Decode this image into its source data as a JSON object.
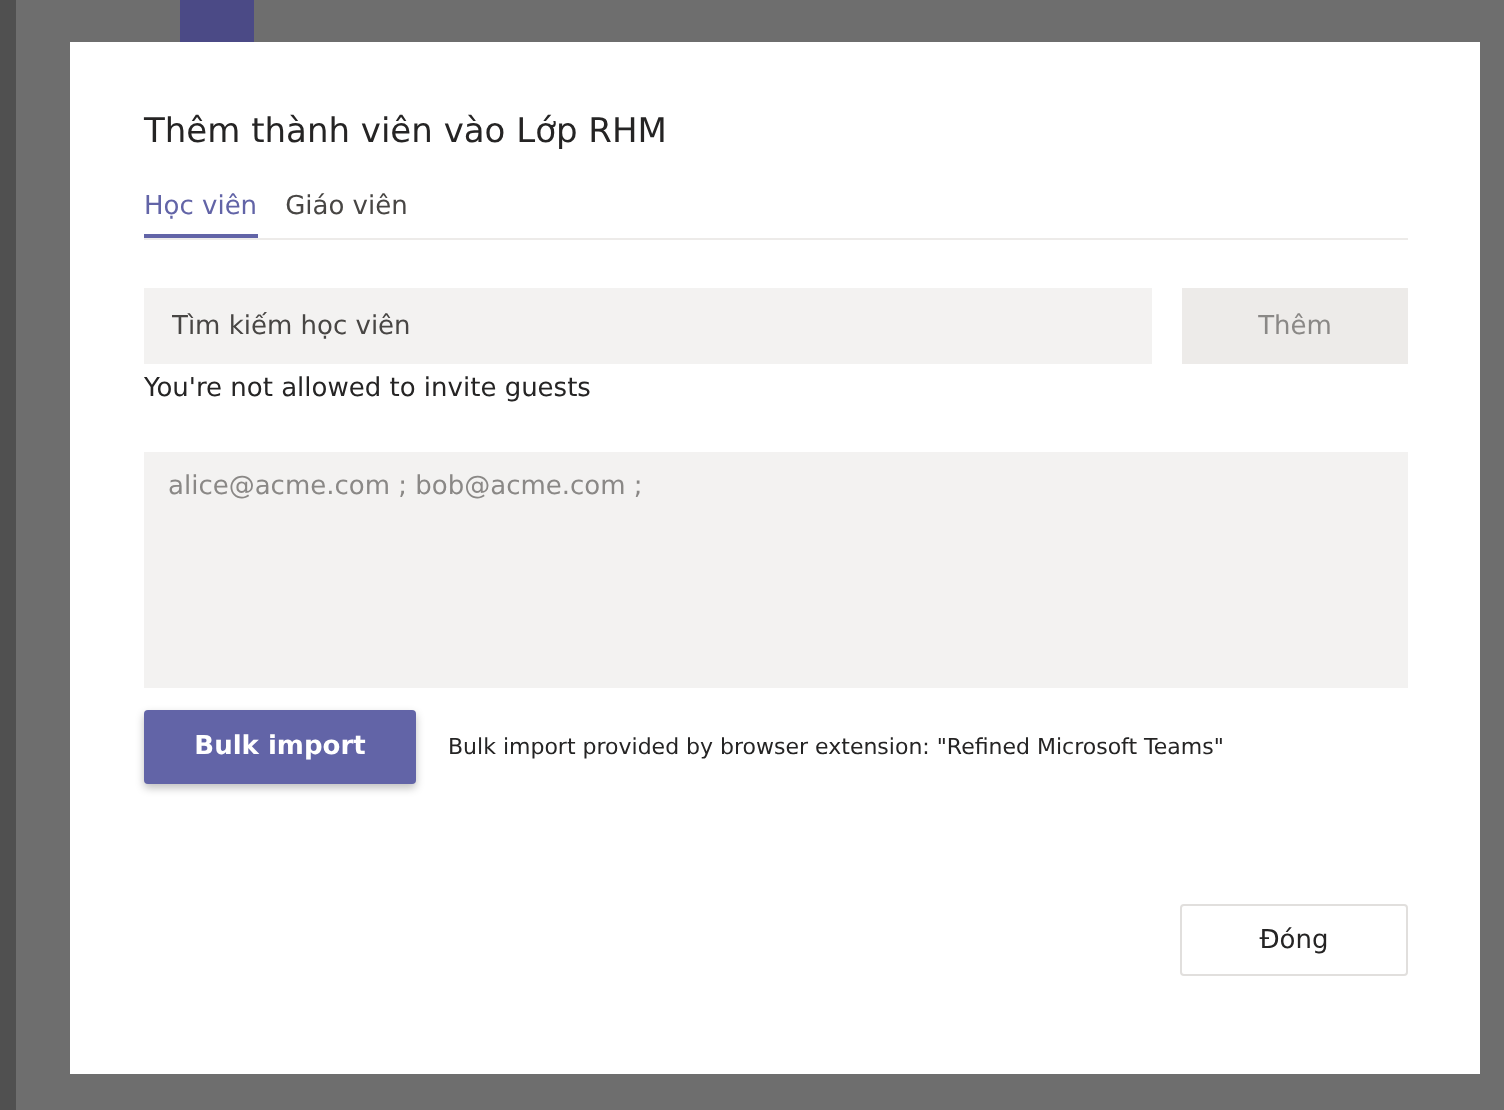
{
  "dialog": {
    "title": "Thêm thành viên vào Lớp RHM",
    "tabs": [
      {
        "label": "Học viên",
        "selected": true
      },
      {
        "label": "Giáo viên",
        "selected": false
      }
    ],
    "search": {
      "placeholder": "Tìm kiếm học viên"
    },
    "add_button": {
      "label": "Thêm",
      "disabled": true
    },
    "warning": "You're not allowed to invite guests",
    "bulk_field": {
      "placeholder": "alice@acme.com ; bob@acme.com ;"
    },
    "bulk_button": "Bulk import",
    "bulk_note": "Bulk import provided by browser extension: \"Refined Microsoft Teams\"",
    "close_button": "Đóng"
  }
}
